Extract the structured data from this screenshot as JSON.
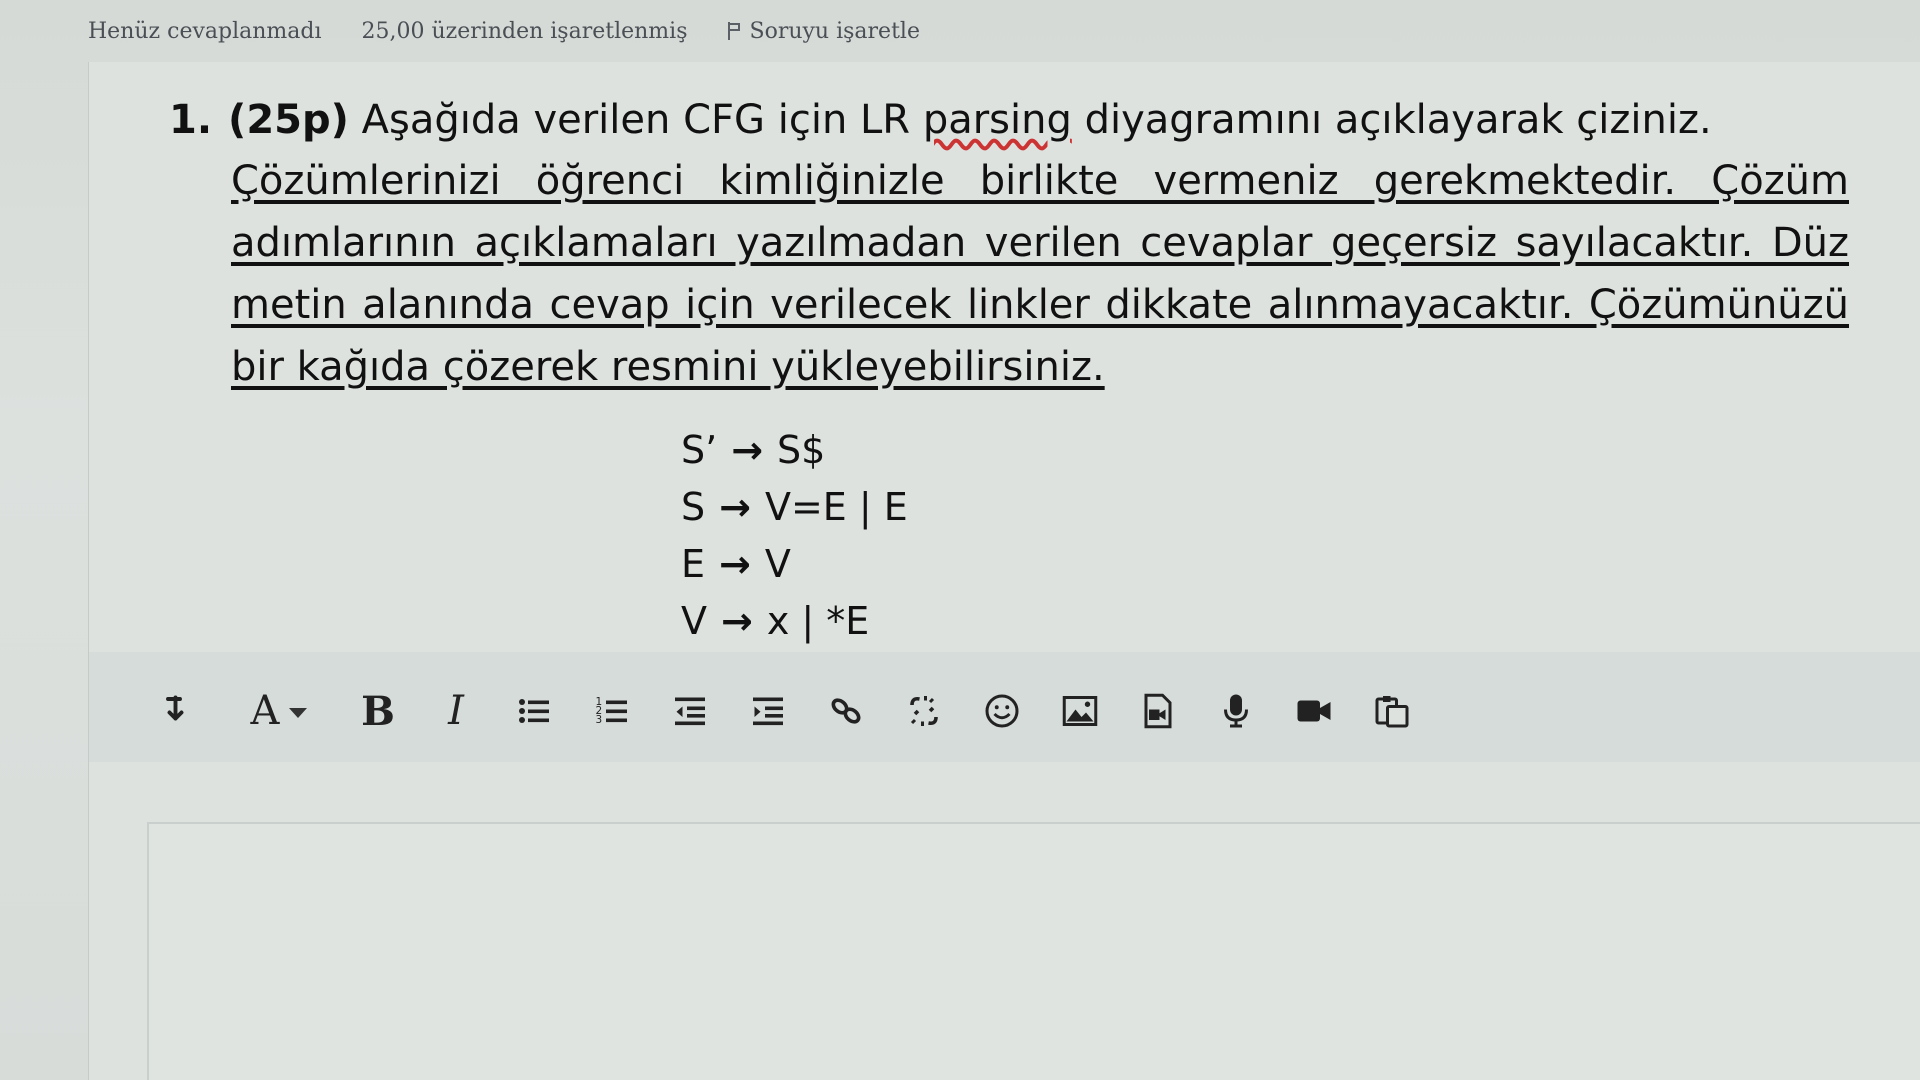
{
  "status": {
    "state": "Henüz cevaplanmadı",
    "grade": "25,00 üzerinden işaretlenmiş",
    "flag_label": "Soruyu işaretle"
  },
  "question": {
    "number": "1.",
    "points": "(25p)",
    "title_before": "Aşağıda verilen CFG için LR",
    "title_squiggle": "parsing",
    "title_after": "diyagramını açıklayarak çiziniz.",
    "body": "Çözümlerinizi öğrenci kimliğinizle birlikte vermeniz gerekmektedir. Çözüm adımlarının açıklamaları yazılmadan verilen cevaplar geçersiz sayılacaktır. Düz metin alanında cevap için verilecek linkler dikkate alınmayacaktır. Çözümünüzü bir kağıda çözerek resmini yükleyebilirsiniz."
  },
  "grammar": [
    {
      "lhs": "S’",
      "arrow": "→",
      "rhs": "S$"
    },
    {
      "lhs": "S",
      "arrow": "→",
      "rhs": "V=E | E"
    },
    {
      "lhs": "E",
      "arrow": "→",
      "rhs": "V"
    },
    {
      "lhs": "V",
      "arrow": "→",
      "rhs": "x | *E"
    }
  ],
  "toolbar": {
    "font_label": "A",
    "bold_label": "B",
    "italic_label": "I",
    "icons": [
      "collapse-icon",
      "font-color-icon",
      "bold-icon",
      "italic-icon",
      "bullet-list-icon",
      "numbered-list-icon",
      "outdent-icon",
      "indent-icon",
      "link-icon",
      "unlink-icon",
      "emoji-icon",
      "image-icon",
      "media-icon",
      "microphone-icon",
      "video-icon",
      "paste-icon"
    ]
  }
}
